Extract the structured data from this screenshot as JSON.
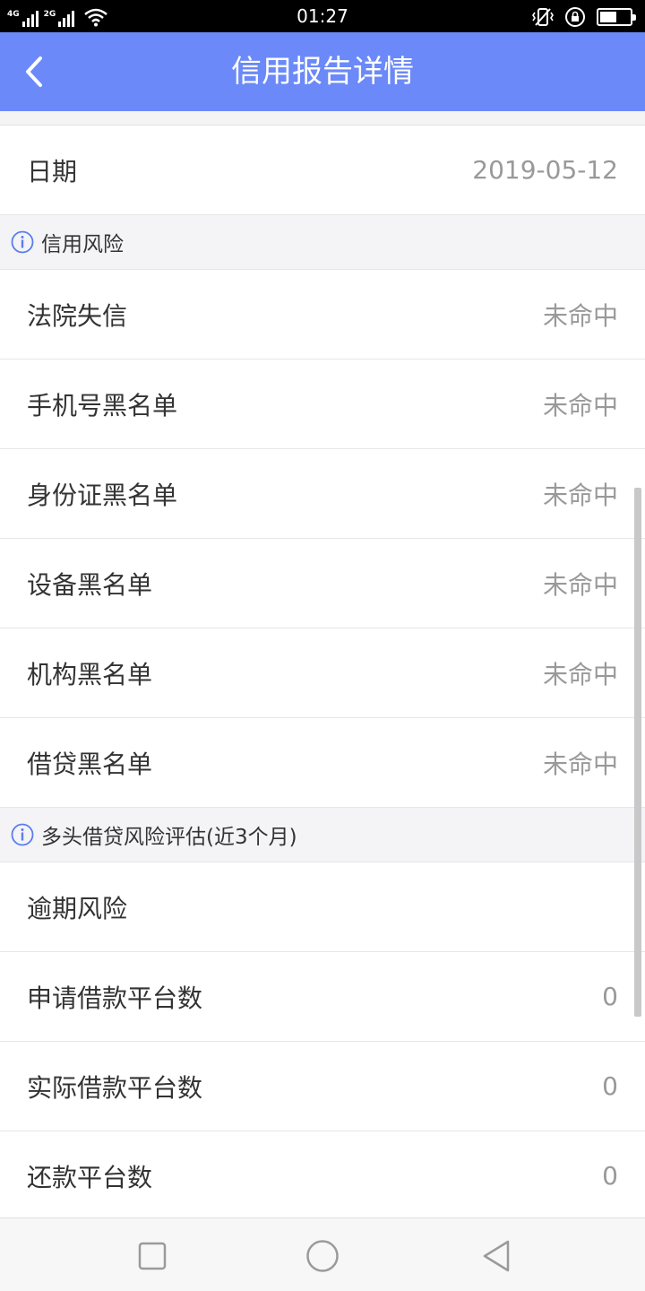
{
  "status_bar": {
    "network_1": "4G",
    "network_2": "2G",
    "time": "01:27",
    "battery_level": 0.55,
    "icons": [
      "signal-icon",
      "wifi-icon",
      "vibrate-icon",
      "rotation-lock-icon",
      "battery-icon"
    ]
  },
  "header": {
    "title": "信用报告详情",
    "background": "#6b89f8"
  },
  "date_row": {
    "label": "日期",
    "value": "2019-05-12"
  },
  "sections": [
    {
      "title": "信用风险",
      "rows": [
        {
          "label": "法院失信",
          "value": "未命中"
        },
        {
          "label": "手机号黑名单",
          "value": "未命中"
        },
        {
          "label": "身份证黑名单",
          "value": "未命中"
        },
        {
          "label": "设备黑名单",
          "value": "未命中"
        },
        {
          "label": "机构黑名单",
          "value": "未命中"
        },
        {
          "label": "借贷黑名单",
          "value": "未命中"
        }
      ]
    },
    {
      "title": "多头借贷风险评估(近3个月)",
      "rows": [
        {
          "label": "逾期风险",
          "value": ""
        },
        {
          "label": "申请借款平台数",
          "value": "0"
        },
        {
          "label": "实际借款平台数",
          "value": "0"
        },
        {
          "label": "还款平台数",
          "value": "0"
        }
      ]
    }
  ],
  "colors": {
    "accent": "#6b89f8",
    "info_icon": "#5b7cf0",
    "label_text": "#333333",
    "value_text": "#999999"
  }
}
